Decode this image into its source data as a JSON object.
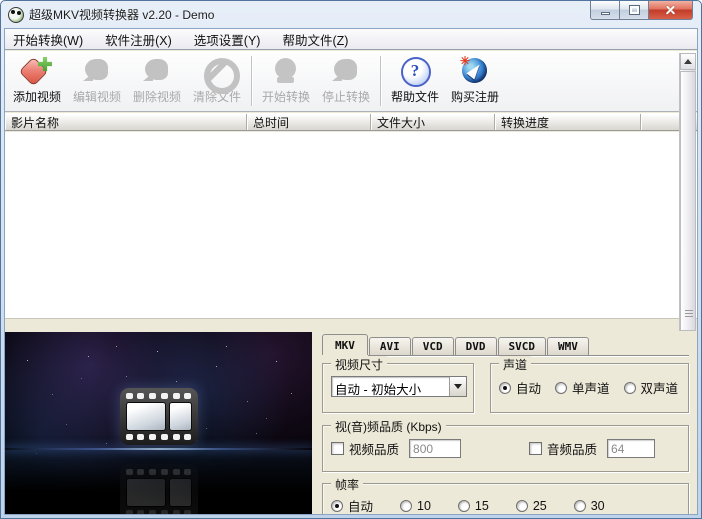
{
  "window": {
    "title": "超级MKV视频转换器 v2.20 - Demo"
  },
  "menu": {
    "items": [
      {
        "label": "开始转换(W)"
      },
      {
        "label": "软件注册(X)"
      },
      {
        "label": "选项设置(Y)"
      },
      {
        "label": "帮助文件(Z)"
      }
    ]
  },
  "toolbar": {
    "buttons": [
      {
        "label": "添加视频",
        "icon": "add-video-icon",
        "enabled": true
      },
      {
        "label": "编辑视频",
        "icon": "edit-video-icon",
        "enabled": false
      },
      {
        "label": "删除视频",
        "icon": "delete-video-icon",
        "enabled": false
      },
      {
        "label": "清除文件",
        "icon": "clear-files-icon",
        "enabled": false
      },
      {
        "label": "开始转换",
        "icon": "start-convert-icon",
        "enabled": false
      },
      {
        "label": "停止转换",
        "icon": "stop-convert-icon",
        "enabled": false
      },
      {
        "label": "帮助文件",
        "icon": "help-icon",
        "enabled": true
      },
      {
        "label": "购买注册",
        "icon": "buy-register-icon",
        "enabled": true
      }
    ]
  },
  "file_list": {
    "columns": [
      {
        "label": "影片名称"
      },
      {
        "label": "总时间"
      },
      {
        "label": "文件大小"
      },
      {
        "label": "转换进度"
      }
    ],
    "rows": []
  },
  "format_tabs": {
    "active": "MKV",
    "tabs": [
      {
        "label": "MKV"
      },
      {
        "label": "AVI"
      },
      {
        "label": "VCD"
      },
      {
        "label": "DVD"
      },
      {
        "label": "SVCD"
      },
      {
        "label": "WMV"
      }
    ]
  },
  "settings": {
    "video_size": {
      "group_label": "视频尺寸",
      "selected": "自动 - 初始大小"
    },
    "audio_channel": {
      "group_label": "声道",
      "options": [
        {
          "label": "自动",
          "selected": true
        },
        {
          "label": "单声道",
          "selected": false
        },
        {
          "label": "双声道",
          "selected": false
        }
      ]
    },
    "quality": {
      "group_label": "视(音)频品质 (Kbps)",
      "video": {
        "label": "视频品质",
        "checked": false,
        "value": "800"
      },
      "audio": {
        "label": "音频品质",
        "checked": false,
        "value": "64"
      }
    },
    "frame_rate": {
      "group_label": "帧率",
      "options": [
        {
          "label": "自动",
          "selected": true
        },
        {
          "label": "10",
          "selected": false
        },
        {
          "label": "15",
          "selected": false
        },
        {
          "label": "25",
          "selected": false
        },
        {
          "label": "30",
          "selected": false
        }
      ]
    }
  },
  "colors": {
    "close_button_red": "#cf4433",
    "panel_background": "#ece9d8",
    "disabled_text_gray": "#a9a9a9",
    "titlebar_blue": "#c2d5ec",
    "list_background": "#ffffff"
  }
}
